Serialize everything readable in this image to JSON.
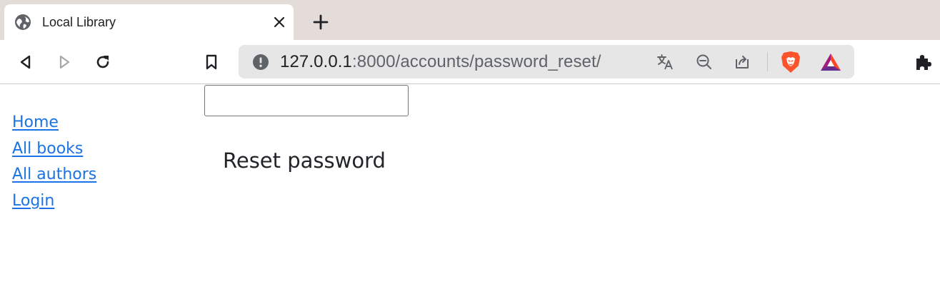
{
  "browser": {
    "tab": {
      "title": "Local Library",
      "favicon": "globe-icon",
      "close_icon": "close-icon"
    },
    "new_tab_icon": "plus-icon",
    "nav": {
      "back_icon": "back-icon",
      "forward_icon": "forward-icon",
      "reload_icon": "reload-icon",
      "bookmark_icon": "bookmark-icon"
    },
    "address_bar": {
      "info_icon": "info-icon",
      "url_host": "127.0.0.1",
      "url_rest": ":8000/accounts/password_reset/",
      "translate_icon": "translate-icon",
      "zoom_icon": "zoom-out-icon",
      "share_icon": "share-icon",
      "brave_shield_icon": "brave-shield-icon",
      "bat_rewards_icon": "bat-rewards-icon"
    },
    "extensions_icon": "puzzle-icon",
    "colors": {
      "tabstrip_bg": "#e3dcd9",
      "omnibox_bg": "#e6e6e6",
      "link": "#1a73e8",
      "brave_orange": "#fb542b"
    }
  },
  "page": {
    "input_value": "",
    "sidebar": {
      "links": [
        {
          "label": "Home"
        },
        {
          "label": "All books"
        },
        {
          "label": "All authors"
        },
        {
          "label": "Login"
        }
      ]
    },
    "heading": "Reset password"
  }
}
